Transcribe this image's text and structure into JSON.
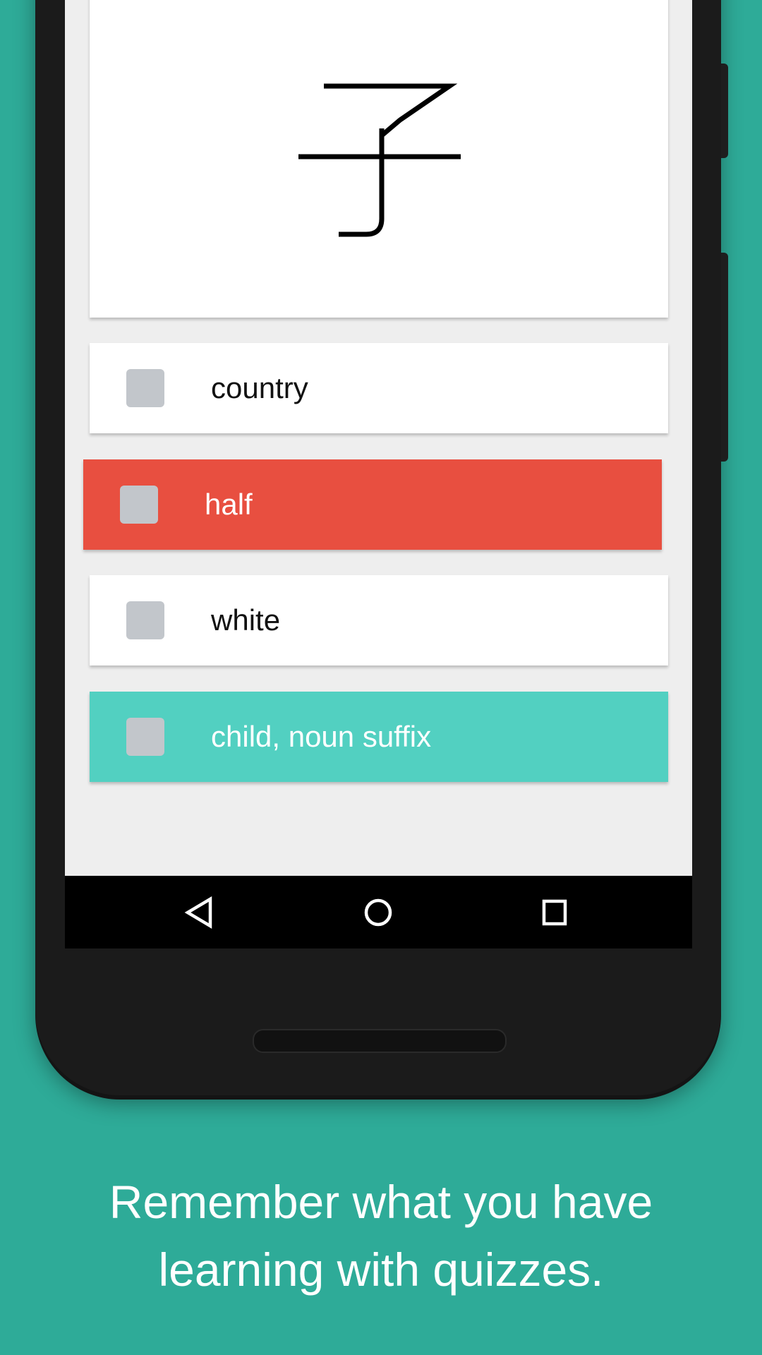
{
  "kanji": "子",
  "answers": [
    {
      "label": "country",
      "state": "default"
    },
    {
      "label": "half",
      "state": "wrong"
    },
    {
      "label": "white",
      "state": "default"
    },
    {
      "label": "child, noun suffix",
      "state": "correct"
    }
  ],
  "nav": {
    "back_icon": "back-triangle",
    "home_icon": "home-circle",
    "recents_icon": "recents-square"
  },
  "caption": {
    "line1": "Remember what you have",
    "line2": "learning with quizzes."
  },
  "colors": {
    "background": "#2eab98",
    "wrong": "#e84f40",
    "correct": "#52d0c1",
    "checkbox": "#c2c6cb"
  }
}
